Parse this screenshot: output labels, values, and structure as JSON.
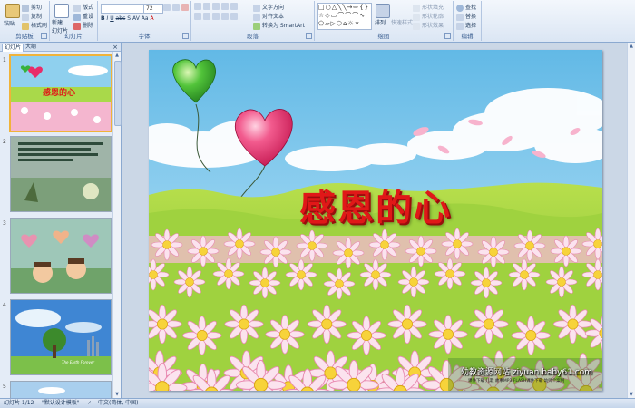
{
  "ribbon": {
    "clipboard": {
      "label": "剪贴板",
      "paste": "粘贴",
      "cut": "剪切",
      "copy": "复制",
      "format_painter": "格式刷"
    },
    "slides": {
      "label": "幻灯片",
      "new_slide": "新建",
      "new_slide_2": "幻灯片",
      "layout": "版式",
      "reset": "重设",
      "delete": "删除"
    },
    "font": {
      "label": "字体",
      "font_name": "",
      "font_size": "72"
    },
    "paragraph": {
      "label": "段落",
      "text_direction": "文字方向",
      "align_text": "对齐文本",
      "convert_smartart": "转换为 SmartArt"
    },
    "drawing": {
      "label": "绘图",
      "arrange": "排列",
      "quick_styles": "快速样式",
      "shape_fill": "形状填充",
      "shape_outline": "形状轮廓",
      "shape_effects": "形状效果"
    },
    "editing": {
      "label": "编辑",
      "find": "查找",
      "replace": "替换",
      "select": "选择"
    }
  },
  "panel": {
    "tab_slides": "幻灯片",
    "tab_outline": "大纲",
    "close": "×",
    "thumbnails": [
      {
        "number": "1",
        "title": "感恩的心"
      },
      {
        "number": "2",
        "title": ""
      },
      {
        "number": "3",
        "title": ""
      },
      {
        "number": "4",
        "title": "The Earth Forever"
      },
      {
        "number": "5",
        "title": ""
      }
    ]
  },
  "slide": {
    "title": "感恩的心",
    "watermark": "幼教资源网站 ziyuan.baby61.com",
    "watermark_sub": "课件下载   儿歌   故事MP3   FLASH课件下载   幼师个案例"
  },
  "status": {
    "slide_counter": "幻灯片 1/12",
    "theme": "\"默认设计模板\"",
    "language": "中文(简体, 中国)"
  },
  "colors": {
    "title": "#e01818",
    "ribbon": "#dbe6f4",
    "selected_border": "#f0b33a"
  }
}
